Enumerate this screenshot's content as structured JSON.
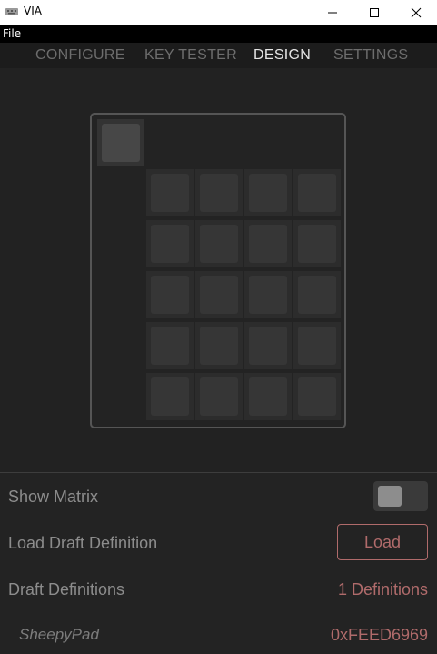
{
  "window": {
    "title": "VIA",
    "app_icon": "keyboard-icon",
    "controls": [
      "minimize-icon",
      "maximize-icon",
      "close-icon"
    ]
  },
  "menubar": {
    "file": "File"
  },
  "tabs": [
    {
      "label": "CONFIGURE",
      "active": false
    },
    {
      "label": "KEY TESTER",
      "active": false
    },
    {
      "label": "DESIGN",
      "active": true
    },
    {
      "label": "SETTINGS",
      "active": false
    }
  ],
  "keyboard": {
    "grid_rows": 5,
    "grid_cols": 4,
    "extra_top_key": true
  },
  "settings": {
    "show_matrix": {
      "label": "Show Matrix",
      "enabled": false
    },
    "load_draft": {
      "label": "Load Draft Definition",
      "button": "Load"
    },
    "draft_definitions": {
      "label": "Draft Definitions",
      "value": "1 Definitions"
    },
    "definition_entry": {
      "name": "SheepyPad",
      "vendor_product_id": "0xFEED6969"
    }
  },
  "colors": {
    "accent": "#b06b6b",
    "background": "#222222",
    "active_tab": "#e6e6e6",
    "inactive_tab": "#6d6d6d"
  }
}
